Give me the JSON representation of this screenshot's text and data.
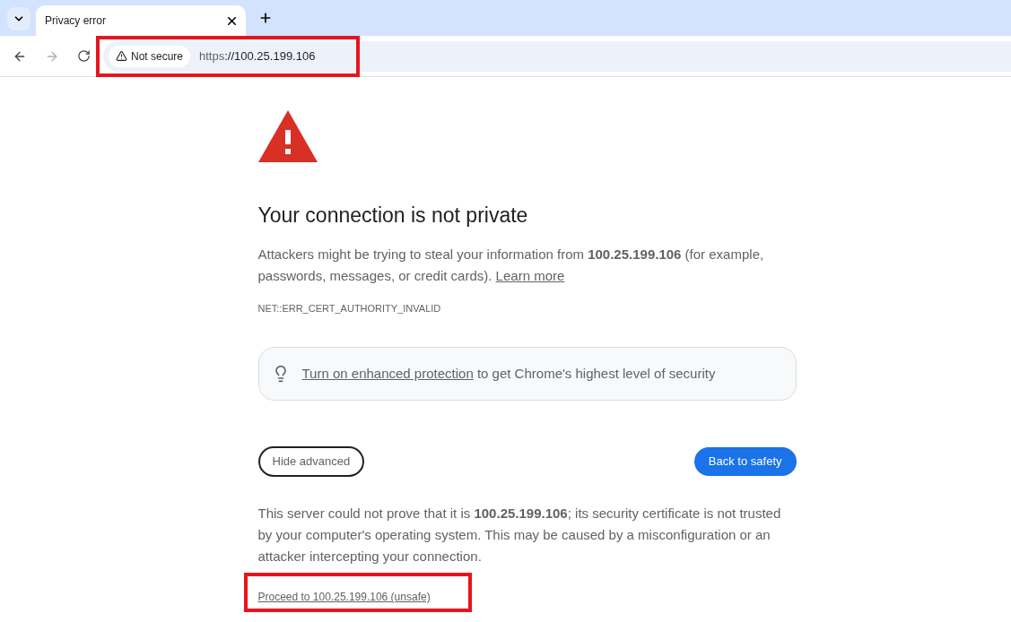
{
  "tab": {
    "title": "Privacy error",
    "selected": true
  },
  "address_bar": {
    "security_label": "Not secure",
    "scheme": "https",
    "rest": "://100.25.199.106",
    "highlighted": true
  },
  "error": {
    "title": "Your connection is not private",
    "message": "Attackers might be trying to steal your information from **100.25.199.106** (for example, passwords, messages, or credit cards).",
    "learn_more": "Learn more",
    "code": "NET::ERR_CERT_AUTHORITY_INVALID",
    "tip_link": "Turn on enhanced protection",
    "tip_text": "to get Chrome's highest level of security",
    "hide_advanced": "Hide advanced",
    "back_to_safety": "Back to safety",
    "details": "This server could not prove that it is **100.25.199.106**; its security certificate is not trusted by your computer's operating system. This may be caused by a misconfiguration or an attacker intercepting your connection.",
    "proceed": "Proceed to 100.25.199.106 (unsafe)",
    "proceed_highlighted": true
  }
}
